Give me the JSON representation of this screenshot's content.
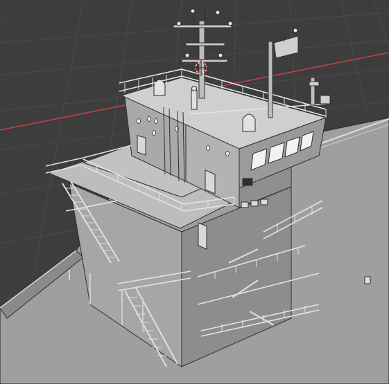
{
  "viewport": {
    "name": "3d-viewport",
    "background": "#3d3d3d",
    "grid_color": "#4a4a4a",
    "x_axis_color": "#c8404a",
    "model_color_light": "#b9b9b9",
    "model_color_mid": "#9d9d9d",
    "model_color_dark": "#7c7c7c",
    "outline_color": "#2e2e2e",
    "origin_marker_color": "#d23a3a",
    "model": "ship-superstructure"
  }
}
